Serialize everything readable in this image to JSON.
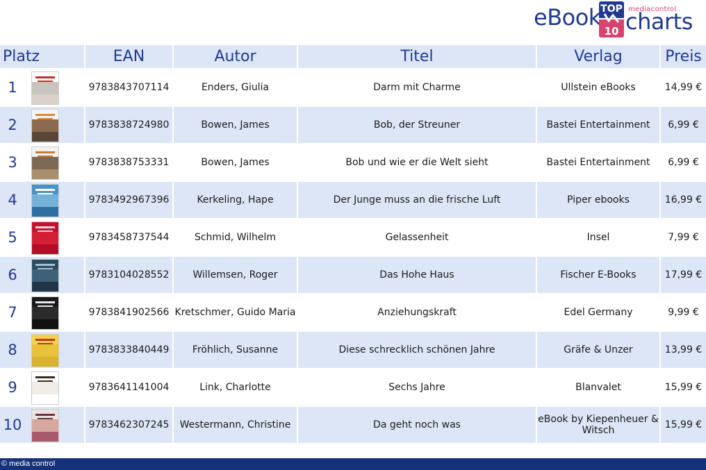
{
  "logo": {
    "ebook": "eBook",
    "top": "TOP",
    "number": "10",
    "mediacontrol": "mediacontrol",
    "charts": "charts"
  },
  "columns": {
    "platz": "Platz",
    "ean": "EAN",
    "autor": "Autor",
    "titel": "Titel",
    "verlag": "Verlag",
    "preis": "Preis"
  },
  "rows": [
    {
      "platz": "1",
      "ean": "9783843707114",
      "autor": "Enders, Giulia",
      "titel": "Darm mit Charme",
      "verlag": "Ullstein eBooks",
      "preis": "14,99 €",
      "cover": {
        "top": "#ffffff",
        "mid": "#c9c4bd",
        "bottom": "#d8d2c8",
        "accent": "#c4302b"
      }
    },
    {
      "platz": "2",
      "ean": "9783838724980",
      "autor": "Bowen, James",
      "titel": "Bob, der Streuner",
      "verlag": "Bastei Entertainment",
      "preis": "6,99 €",
      "cover": {
        "top": "#f4f4f4",
        "mid": "#8b6b4e",
        "bottom": "#5a4636",
        "accent": "#d98a3c"
      }
    },
    {
      "platz": "3",
      "ean": "9783838753331",
      "autor": "Bowen, James",
      "titel": "Bob und wie er die Welt sieht",
      "verlag": "Bastei Entertainment",
      "preis": "6,99 €",
      "cover": {
        "top": "#f2f2f2",
        "mid": "#7d6a55",
        "bottom": "#a88f6e",
        "accent": "#c87b35"
      }
    },
    {
      "platz": "4",
      "ean": "9783492967396",
      "autor": "Kerkeling, Hape",
      "titel": "Der Junge muss an die frische Luft",
      "verlag": "Piper ebooks",
      "preis": "16,99 €",
      "cover": {
        "top": "#4a93c8",
        "mid": "#76b1d8",
        "bottom": "#2f6f9f",
        "accent": "#ffffff"
      }
    },
    {
      "platz": "5",
      "ean": "9783458737544",
      "autor": "Schmid, Wilhelm",
      "titel": "Gelassenheit",
      "verlag": "Insel",
      "preis": "7,99 €",
      "cover": {
        "top": "#c8102e",
        "mid": "#d32037",
        "bottom": "#b50d28",
        "accent": "#f5d5da"
      }
    },
    {
      "platz": "6",
      "ean": "9783104028552",
      "autor": "Willemsen, Roger",
      "titel": "Das Hohe Haus",
      "verlag": "Fischer E-Books",
      "preis": "17,99 €",
      "cover": {
        "top": "#2f4a5f",
        "mid": "#3f6079",
        "bottom": "#203545",
        "accent": "#9fc1d8"
      }
    },
    {
      "platz": "7",
      "ean": "9783841902566",
      "autor": "Kretschmer, Guido Maria",
      "titel": "Anziehungskraft",
      "verlag": "Edel Germany",
      "preis": "9,99 €",
      "cover": {
        "top": "#1a1a1a",
        "mid": "#2b2b2b",
        "bottom": "#111111",
        "accent": "#e8e8e8"
      }
    },
    {
      "platz": "8",
      "ean": "9783833840449",
      "autor": "Fröhlich, Susanne",
      "titel": "Diese schrecklich schönen Jahre",
      "verlag": "Gräfe & Unzer",
      "preis": "13,99 €",
      "cover": {
        "top": "#f2d24a",
        "mid": "#e8c23a",
        "bottom": "#d9b230",
        "accent": "#c0392b"
      }
    },
    {
      "platz": "9",
      "ean": "9783641141004",
      "autor": "Link, Charlotte",
      "titel": "Sechs Jahre",
      "verlag": "Blanvalet",
      "preis": "15,99 €",
      "cover": {
        "top": "#ffffff",
        "mid": "#f0ece6",
        "bottom": "#ffffff",
        "accent": "#3a2a20"
      }
    },
    {
      "platz": "10",
      "ean": "9783462307245",
      "autor": "Westermann, Christine",
      "titel": "Da geht noch was",
      "verlag": "eBook by Kiepenheuer & Witsch",
      "preis": "15,99 €",
      "cover": {
        "top": "#e9e4df",
        "mid": "#d6a99e",
        "bottom": "#a85a6a",
        "accent": "#7a2d44"
      }
    }
  ],
  "footer": {
    "copyright": "© media control"
  }
}
